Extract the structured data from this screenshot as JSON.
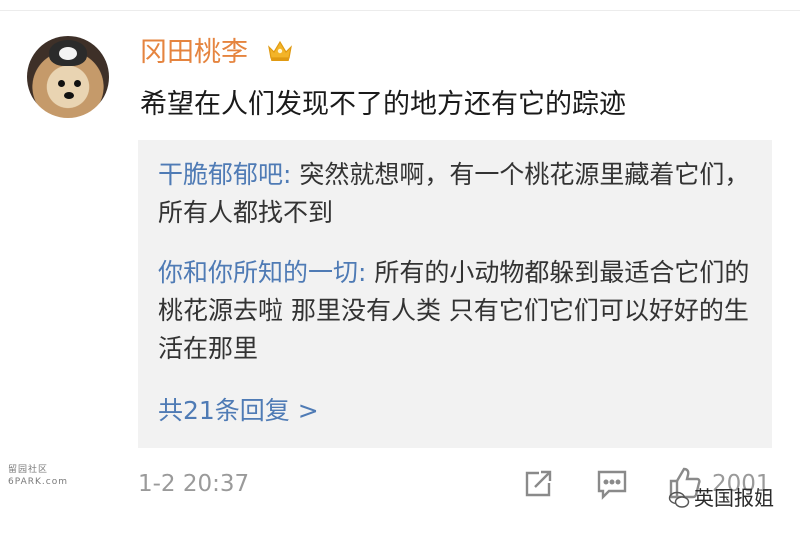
{
  "comment": {
    "username": "冈田桃李",
    "text": "希望在人们发现不了的地方还有它的踪迹",
    "timestamp": "1-2 20:37",
    "like_count": "2001"
  },
  "replies": [
    {
      "username": "干脆郁郁吧",
      "separator": ": ",
      "text": "突然就想啊，有一个桃花源里藏着它们，所有人都找不到"
    },
    {
      "username": "你和你所知的一切",
      "separator": ": ",
      "text": "所有的小动物都躲到最适合它们的桃花源去啦 那里没有人类 只有它们它们可以好好的生活在那里"
    }
  ],
  "more_replies_label": "共21条回复 >",
  "watermarks": {
    "left_line1": "留园社区",
    "left_line2": "6PARK.com",
    "right": "英国报姐"
  },
  "colors": {
    "username": "#e5843f",
    "reply_username": "#4f7bb5",
    "reply_box_bg": "#f2f2f2",
    "meta_text": "#9a9a9a"
  },
  "icons": [
    "avatar",
    "crown-badge-icon",
    "share-icon",
    "reply-icon",
    "like-icon",
    "wechat-icon"
  ]
}
